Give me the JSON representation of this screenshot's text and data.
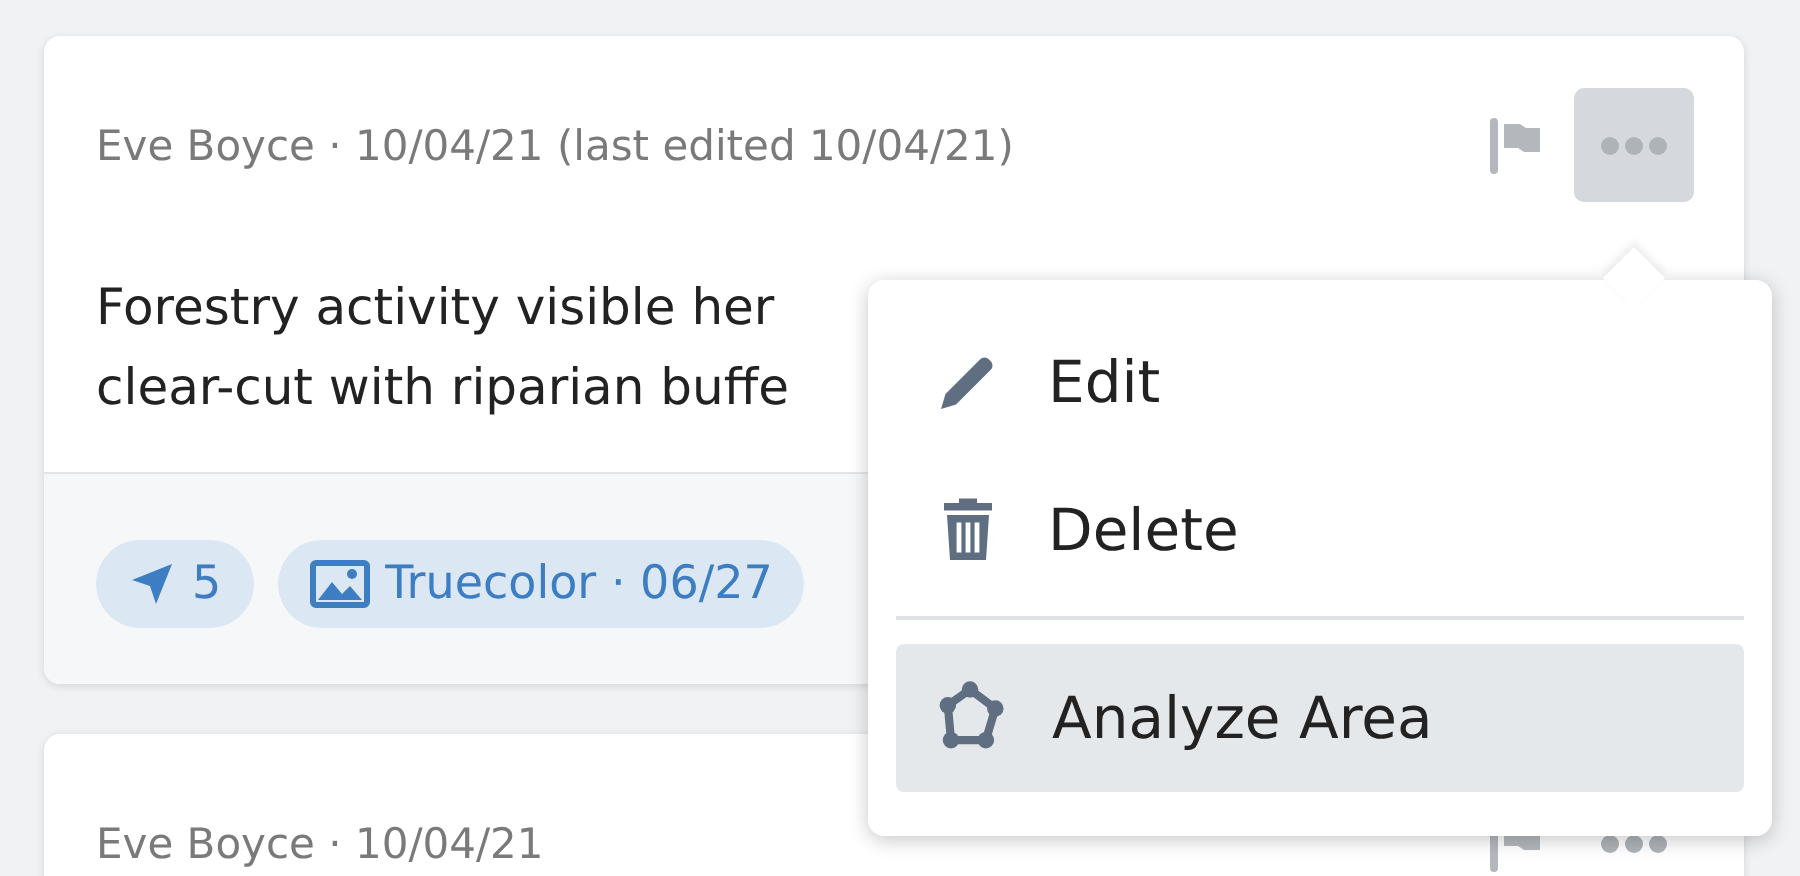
{
  "comments": [
    {
      "meta": "Eve Boyce · 10/04/21 (last edited 10/04/21)",
      "menu_open": true,
      "body_lines": [
        "Forestry activity visible her",
        "clear-cut with riparian buffe"
      ],
      "chips": [
        {
          "kind": "location",
          "label": "5"
        },
        {
          "kind": "image",
          "label": "Truecolor · 06/27"
        }
      ]
    },
    {
      "meta": "Eve Boyce · 10/04/21",
      "menu_open": false
    }
  ],
  "menu": {
    "items": [
      {
        "kind": "edit",
        "label": "Edit",
        "selected": false
      },
      {
        "kind": "delete",
        "label": "Delete",
        "selected": false
      },
      {
        "kind": "divider"
      },
      {
        "kind": "analyze",
        "label": "Analyze Area",
        "selected": true
      }
    ]
  }
}
